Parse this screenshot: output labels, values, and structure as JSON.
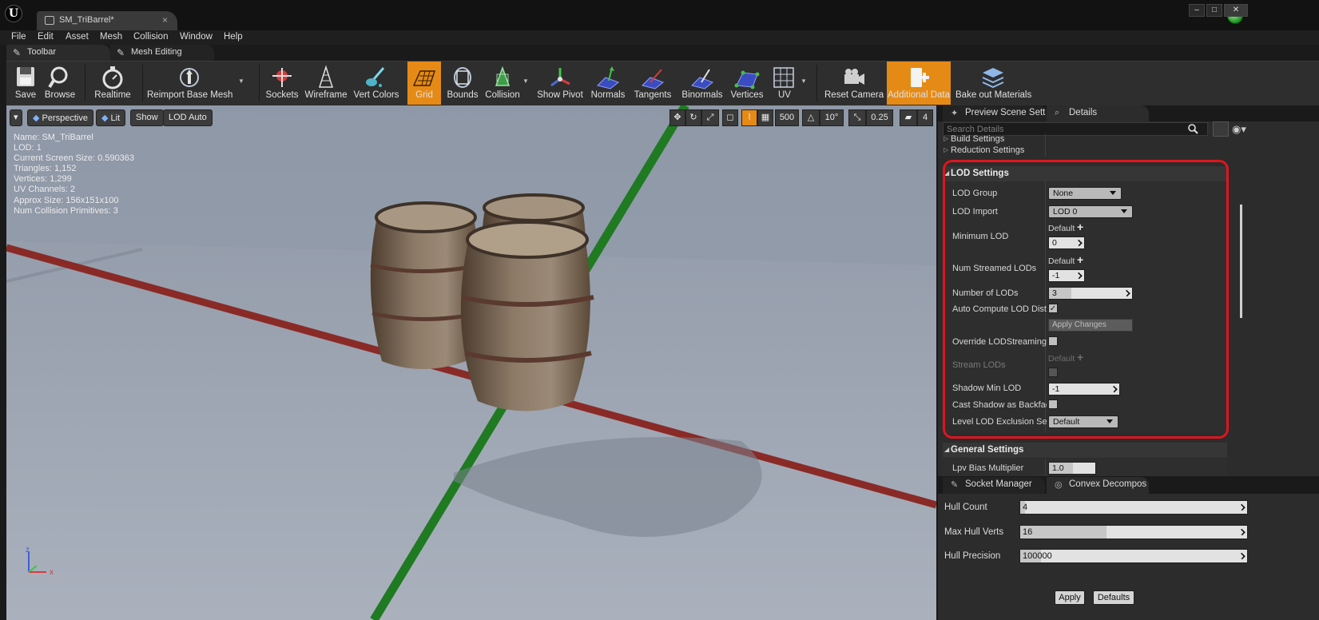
{
  "window": {
    "tab_title": "SM_TriBarrel*",
    "minimize": "–",
    "maximize": "□",
    "close": "✕"
  },
  "menu": [
    "File",
    "Edit",
    "Asset",
    "Mesh",
    "Collision",
    "Window",
    "Help"
  ],
  "toolbar_tabs": [
    "Toolbar",
    "Mesh Editing"
  ],
  "toolbar": {
    "save": "Save",
    "browse": "Browse",
    "realtime": "Realtime",
    "reimport": "Reimport Base Mesh",
    "sockets": "Sockets",
    "wireframe": "Wireframe",
    "vert_colors": "Vert Colors",
    "grid": "Grid",
    "bounds": "Bounds",
    "collision": "Collision",
    "show_pivot": "Show Pivot",
    "normals": "Normals",
    "tangents": "Tangents",
    "binormals": "Binormals",
    "vertices": "Vertices",
    "uv": "UV",
    "reset_camera": "Reset Camera",
    "additional_data": "Additional Data",
    "bake_out": "Bake out Materials"
  },
  "viewport": {
    "perspective": "Perspective",
    "lit": "Lit",
    "show": "Show",
    "lod": "LOD Auto",
    "grid_size": "500",
    "rot_snap": "10°",
    "scale_snap": "0.25",
    "cam_speed": "4",
    "stats": [
      "Name: SM_TriBarrel",
      "LOD: 1",
      "Current Screen Size: 0.590363",
      "Triangles: 1,152",
      "Vertices: 1,299",
      "UV Channels: 2",
      "Approx Size: 156x151x100",
      "Num Collision Primitives: 3"
    ],
    "axis_x": "x",
    "axis_z": "z"
  },
  "details": {
    "tab_preview": "Preview Scene Sett",
    "tab_details": "Details",
    "search_placeholder": "Search Details",
    "build_settings": "Build Settings",
    "reduction_settings": "Reduction Settings",
    "lod_settings": "LOD Settings",
    "lod_group_label": "LOD Group",
    "lod_group_value": "None",
    "lod_import_label": "LOD Import",
    "lod_import_value": "LOD 0",
    "min_lod_label": "Minimum LOD",
    "min_lod_default": "Default",
    "min_lod_value": "0",
    "num_streamed_label": "Num Streamed LODs",
    "num_streamed_default": "Default",
    "num_streamed_value": "-1",
    "num_lods_label": "Number of LODs",
    "num_lods_value": "3",
    "auto_compute_label": "Auto Compute LOD Distances",
    "apply_changes": "Apply Changes",
    "override_label": "Override LODStreaming Settings",
    "stream_lods_label": "Stream LODs",
    "stream_lods_default": "Default",
    "shadow_min_label": "Shadow Min LOD",
    "shadow_min_value": "-1",
    "cast_shadow_label": "Cast Shadow as Backfaced",
    "level_lod_label": "Level LOD Exclusion Settings",
    "level_lod_value": "Default",
    "general_settings": "General Settings",
    "lpv_label": "Lpv Bias Multiplier",
    "lpv_value": "1.0"
  },
  "bottom": {
    "tab_socket": "Socket Manager",
    "tab_convex": "Convex Decompos",
    "hull_count_label": "Hull Count",
    "hull_count_value": "4",
    "max_hull_label": "Max Hull Verts",
    "max_hull_value": "16",
    "hull_precision_label": "Hull Precision",
    "hull_precision_value": "100000",
    "apply": "Apply",
    "defaults": "Defaults"
  },
  "colors": {
    "accent_orange": "#e68a16",
    "highlight_ring": "#e0141e",
    "x_axis": "#8a2a26",
    "y_axis": "#1f7a22"
  }
}
